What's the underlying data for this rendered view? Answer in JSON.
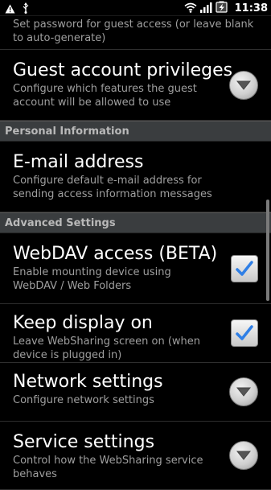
{
  "status_bar": {
    "time": "11:38",
    "icons": [
      "warning-icon",
      "usb-icon",
      "wifi-icon",
      "signal-icon",
      "battery-charging-icon"
    ]
  },
  "items": {
    "password_summary": "Set password for guest access (or leave blank to auto-generate)",
    "guest_title": "Guest account privileges",
    "guest_summary": "Configure which features the guest account will be allowed to use",
    "personal_header": "Personal Information",
    "email_title": "E-mail address",
    "email_summary": "Configure default e-mail address for sending access information messages",
    "advanced_header": "Advanced Settings",
    "webdav_title": "WebDAV access (BETA)",
    "webdav_summary": "Enable mounting device using WebDAV / Web Folders",
    "webdav_checked": true,
    "keep_title": "Keep display on",
    "keep_summary": "Leave WebSharing screen on (when device is plugged in)",
    "keep_checked": true,
    "network_title": "Network settings",
    "network_summary": "Configure network settings",
    "service_title": "Service settings",
    "service_summary": "Control how the WebSharing service behaves"
  },
  "colors": {
    "background": "#000000",
    "header_bg": "#3a3d3f",
    "check_blue": "#2f7fe6",
    "summary_text": "#9f9f9f"
  }
}
